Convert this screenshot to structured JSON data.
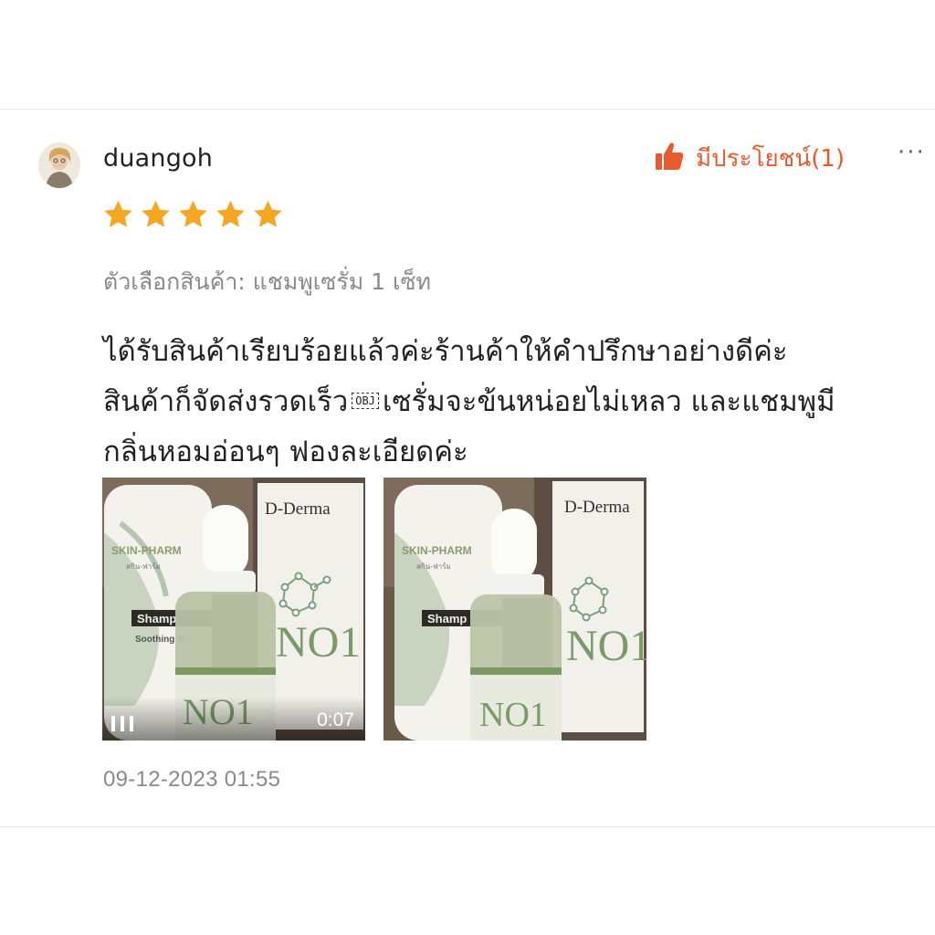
{
  "review": {
    "username": "duangoh",
    "helpful_label": "มีประโยชน์(1)",
    "more_label": "···",
    "rating": 5,
    "variation": "ตัวเลือกสินค้า: แชมพูเซรั่ม 1 เซ็ท",
    "text_line1": "ได้รับสินค้าเรียบร้อยแล้วค่ะร้านค้าให้คำปรึกษาอย่างดีค่ะ",
    "text_line2_part1": "สินค้าก็จัดส่งรวดเร็ว",
    "obj_placeholder": "OBJ",
    "text_line2_part2": "เซรั่มจะข้นหน่อยไม่เหลว และแชมพูมี",
    "text_line3": "กลิ่นหอมอ่อนๆ ฟองละเอียดค่ะ",
    "media": [
      {
        "type": "video",
        "duration": "0:07"
      },
      {
        "type": "image"
      }
    ],
    "date": "09-12-2023 01:55"
  },
  "product_labels": {
    "brand_box": "D-Derma",
    "bottle_brand": "SKIN-PHARM",
    "bottle_sub": "สกิน-ฟาร์ม",
    "bottle_type": "Shamp",
    "bottle_desc": "Soothing Tr",
    "serum_mark": "NO1"
  },
  "colors": {
    "accent": "#e65c2f",
    "star": "#f5a623",
    "muted_text": "#8a8a8a"
  }
}
